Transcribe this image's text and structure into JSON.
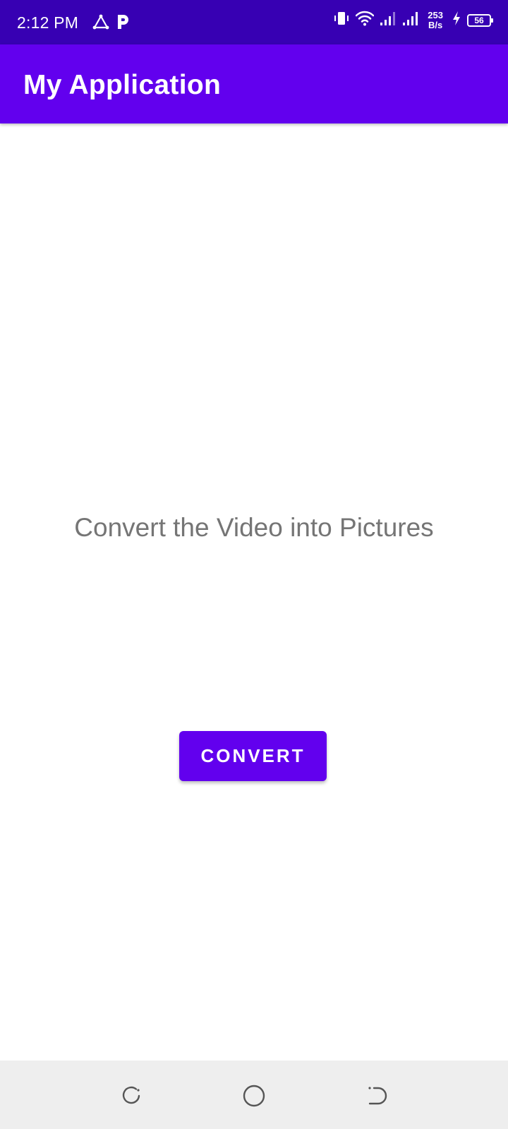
{
  "status_bar": {
    "time": "2:12 PM",
    "net_speed_value": "253",
    "net_speed_unit": "B/s",
    "battery_level": "56",
    "icons": [
      "triangle-share-icon",
      "p-app-icon",
      "vibrate-icon",
      "wifi-icon",
      "signal-1-icon",
      "signal-2-icon",
      "charging-bolt-icon",
      "battery-icon"
    ]
  },
  "app_bar": {
    "title": "My Application"
  },
  "main": {
    "message": "Convert the Video into Pictures",
    "convert_label": "CONVERT"
  },
  "nav_bar": {
    "icons": [
      "recents-icon",
      "home-icon",
      "back-icon"
    ]
  },
  "colors": {
    "status_bar": "#3700B3",
    "primary": "#6200EE",
    "text_secondary": "#757575",
    "nav_bar": "#EEEEEE"
  }
}
